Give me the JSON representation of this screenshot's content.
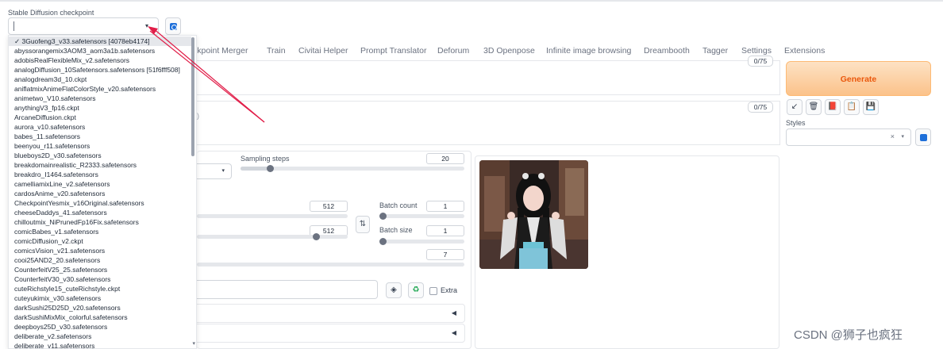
{
  "checkpoint": {
    "label": "Stable Diffusion checkpoint",
    "selected_value": "",
    "options": [
      "✓ 3Guofeng3_v33.safetensors [4078eb4174]",
      "abyssorangemix3AOM3_aom3a1b.safetensors",
      "adobisRealFlexibleMix_v2.safetensors",
      "analogDiffusion_10Safetensors.safetensors [51f6fff508]",
      "analogdream3d_10.ckpt",
      "aniflatmixAnimeFlatColorStyle_v20.safetensors",
      "animetwo_V10.safetensors",
      "anythingV3_fp16.ckpt",
      "ArcaneDiffusion.ckpt",
      "aurora_v10.safetensors",
      "babes_11.safetensors",
      "beenyou_r11.safetensors",
      "blueboys2D_v30.safetensors",
      "breakdomainrealistic_R2333.safetensors",
      "breakdro_I1464.safetensors",
      "camelliamixLine_v2.safetensors",
      "cardosAnime_v20.safetensors",
      "CheckpointYesmix_v16Original.safetensors",
      "cheeseDaddys_41.safetensors",
      "chilloutmix_NiPrunedFp16Fix.safetensors",
      "comicBabes_v1.safetensors",
      "comicDiffusion_v2.ckpt",
      "comicsVision_v21.safetensors",
      "cooi25AND2_20.safetensors",
      "CounterfeitV25_25.safetensors",
      "CounterfeitV30_v30.safetensors",
      "cuteRichstyle15_cuteRichstyle.ckpt",
      "cuteyukimix_v30.safetensors",
      "darkSushi25D25D_v20.safetensors",
      "darkSushiMixMix_colorful.safetensors",
      "deepboys25D_v30.safetensors",
      "deliberate_v2.safetensors",
      "deliberate_v11.safetensors"
    ]
  },
  "tabs": [
    "ckpoint Merger",
    "Train",
    "Civitai Helper",
    "Prompt Translator",
    "Deforum",
    "3D Openpose",
    "Infinite image browsing",
    "Dreambooth",
    "Tagger",
    "Settings",
    "Extensions"
  ],
  "prompt": {
    "counter": "0/75"
  },
  "negative_prompt": {
    "counter": "0/75",
    "hint": ")"
  },
  "generate_label": "Generate",
  "tools": [
    "↙",
    "🗑",
    "📕",
    "📋",
    "💾"
  ],
  "styles": {
    "label": "Styles",
    "clear": "×",
    "arrow": "▾"
  },
  "settings": {
    "sampling_steps_label": "Sampling steps",
    "sampling_steps_value": "20",
    "sampling_steps_fraction": 0.13,
    "width_value": "512",
    "height_value": "512",
    "batch_count_label": "Batch count",
    "batch_count_value": "1",
    "batch_size_label": "Batch size",
    "batch_size_value": "1",
    "cfg_value": "7",
    "swap_icon": "⇅",
    "extra_label": "Extra"
  },
  "watermark": "CSDN @狮子也疯狂",
  "colors": {
    "generate_text": "#ea580c",
    "accent_blue": "#1e6fd9",
    "arrow_red": "#e11d48"
  }
}
